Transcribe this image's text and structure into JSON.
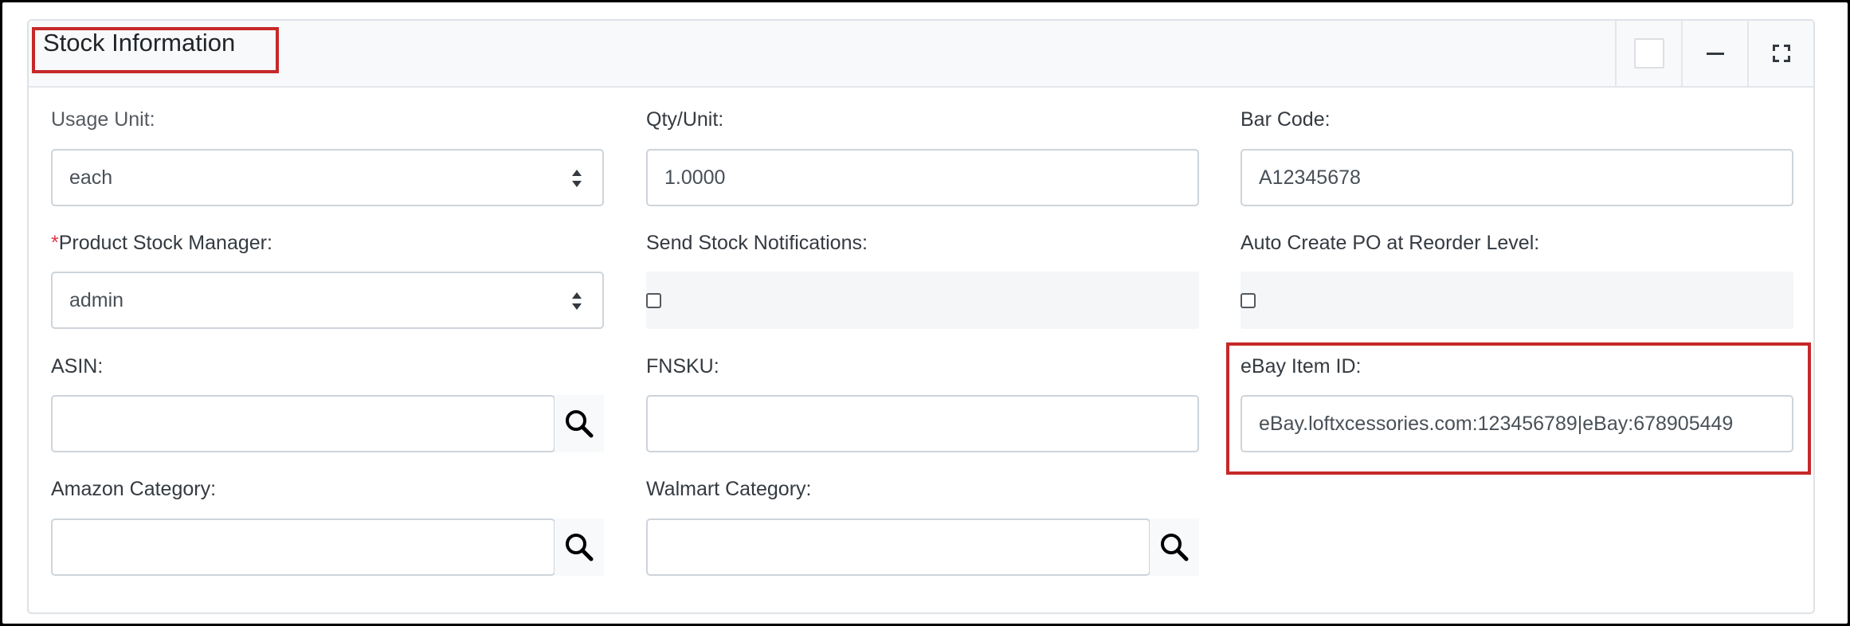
{
  "card": {
    "title": "Stock Information",
    "tools": [
      {
        "icon": "blank-square-icon"
      },
      {
        "icon": "minimize-icon"
      },
      {
        "icon": "expand-icon"
      }
    ]
  },
  "fields": {
    "usage_unit": {
      "label": "Usage Unit:",
      "value": "each"
    },
    "qty_unit": {
      "label": "Qty/Unit:",
      "value": "1.0000"
    },
    "bar_code": {
      "label": "Bar Code:",
      "value": "A12345678"
    },
    "stock_manager": {
      "required_mark": "*",
      "label": "Product Stock Manager:",
      "value": "admin"
    },
    "send_notifications": {
      "label": "Send Stock Notifications:",
      "checked": false
    },
    "auto_po": {
      "label": "Auto Create PO at Reorder Level:",
      "checked": false
    },
    "asin": {
      "label": "ASIN:",
      "value": "",
      "icon": "search-icon"
    },
    "fnsku": {
      "label": "FNSKU:",
      "value": ""
    },
    "ebay_item_id": {
      "label": "eBay Item ID:",
      "value": "eBay.loftxcessories.com:123456789|eBay:678905449"
    },
    "amazon_category": {
      "label": "Amazon Category:",
      "value": "",
      "icon": "search-icon"
    },
    "walmart_category": {
      "label": "Walmart Category:",
      "value": "",
      "icon": "search-icon"
    }
  },
  "colors": {
    "highlight": "#c62828",
    "required": "#dc3545",
    "border": "#ced4da"
  }
}
